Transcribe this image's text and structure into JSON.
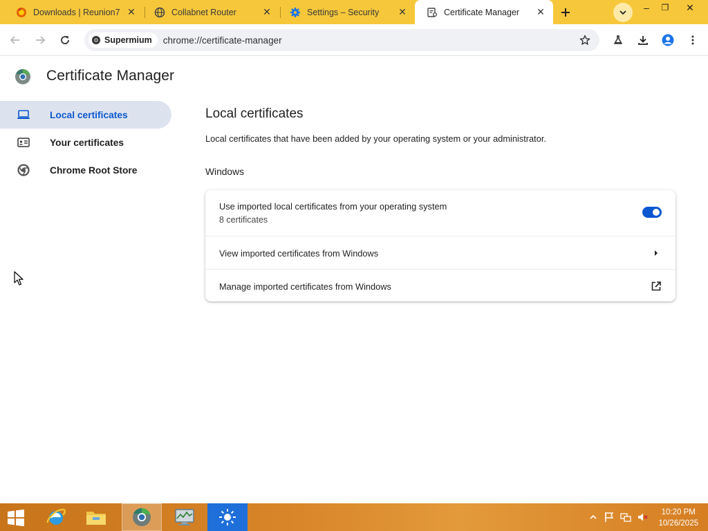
{
  "tabs": [
    {
      "title": "Downloads | Reunion7",
      "icon": "firefox-icon"
    },
    {
      "title": "Collabnet Router",
      "icon": "globe-icon"
    },
    {
      "title": "Settings – Security",
      "icon": "settings-gear-icon"
    },
    {
      "title": "Certificate Manager",
      "icon": "certificate-icon",
      "active": true
    }
  ],
  "window_controls": {
    "minimize": "–",
    "restore": "❐",
    "close": "✕"
  },
  "toolbar": {
    "browser_chip": "Supermium",
    "url": "chrome://certificate-manager"
  },
  "page": {
    "title": "Certificate Manager"
  },
  "sidebar": {
    "items": [
      {
        "label": "Local certificates",
        "icon": "laptop-icon",
        "selected": true
      },
      {
        "label": "Your certificates",
        "icon": "id-card-icon"
      },
      {
        "label": "Chrome Root Store",
        "icon": "chrome-icon"
      }
    ]
  },
  "main": {
    "section_title": "Local certificates",
    "section_description": "Local certificates that have been added by your operating system or your administrator.",
    "subheading": "Windows",
    "rows": [
      {
        "primary": "Use imported local certificates from your operating system",
        "secondary": "8 certificates",
        "toggle_on": true
      },
      {
        "primary": "View imported certificates from Windows"
      },
      {
        "primary": "Manage imported certificates from Windows"
      }
    ]
  },
  "taskbar": {
    "apps": [
      "internet-explorer-icon",
      "file-explorer-icon",
      "supermium-icon",
      "performance-monitor-icon",
      "sun-app-icon"
    ],
    "clock": {
      "time": "10:20 PM",
      "date": "10/26/2025"
    }
  },
  "colors": {
    "accent": "#0b57d0",
    "tabstrip": "#f6c73a",
    "selected_nav_bg": "#dde3ee",
    "taskbar": "#d88428"
  }
}
